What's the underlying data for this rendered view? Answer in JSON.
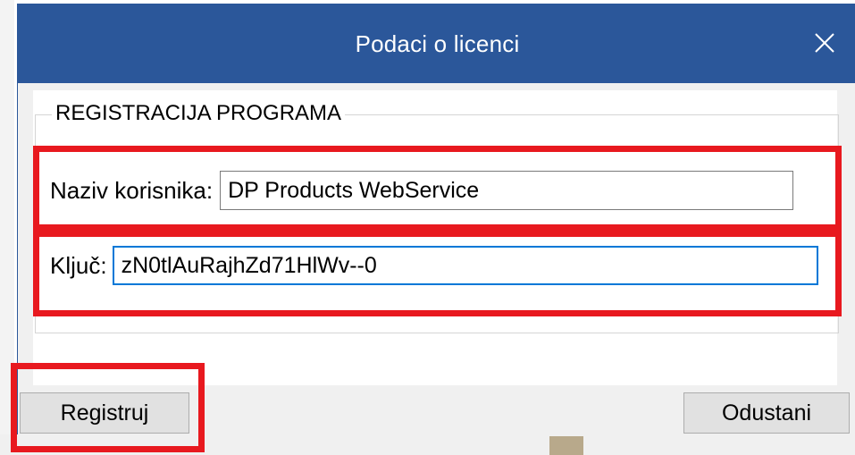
{
  "window": {
    "title": "Podaci o licenci",
    "close_icon": "close-icon"
  },
  "group": {
    "legend": "REGISTRACIJA PROGRAMA"
  },
  "fields": {
    "username": {
      "label": "Naziv korisnika:",
      "value": "DP Products WebService"
    },
    "key": {
      "label": "Ključ:",
      "value": "zN0tlAuRajhZd71HlWv--0"
    }
  },
  "buttons": {
    "register": "Registruj",
    "cancel": "Odustani"
  },
  "colors": {
    "titlebar": "#2b579a",
    "highlight": "#e8191f",
    "focus_border": "#0078d7"
  }
}
